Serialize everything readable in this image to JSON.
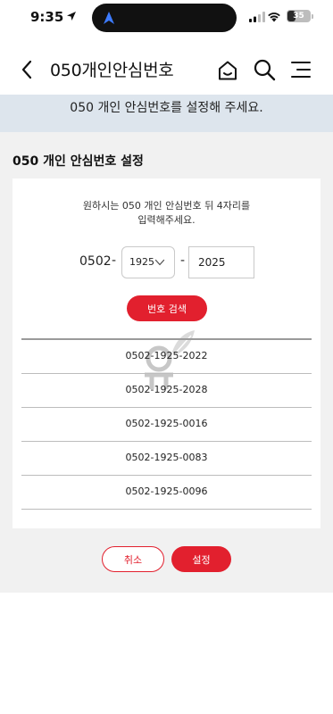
{
  "status_bar": {
    "time": "9:35",
    "battery": "35",
    "battery_level": 0.35
  },
  "header": {
    "title": "050개인안심번호",
    "icons": [
      "back-icon",
      "home-icon",
      "search-icon",
      "menu-icon"
    ]
  },
  "banner": {
    "text": "050 개인 안심번호를 설정해 주세요."
  },
  "section": {
    "title": "050 개인 안심번호 설정"
  },
  "form": {
    "instruction_line1": "원하시는 050 개인 안심번호 뒤 4자리를",
    "instruction_line2": "입력해주세요.",
    "prefix": "0502",
    "dash": "-",
    "middle_selected": "1925",
    "last_value": "2025",
    "search_label": "번호 검색"
  },
  "results": [
    "0502-1925-2022",
    "0502-1925-2028",
    "0502-1925-0016",
    "0502-1925-0083",
    "0502-1925-0096"
  ],
  "actions": {
    "cancel_label": "취소",
    "set_label": "설정"
  },
  "colors": {
    "accent": "#e2202e",
    "banner_bg": "#dde5ed",
    "page_bg": "#f1f1f1"
  }
}
